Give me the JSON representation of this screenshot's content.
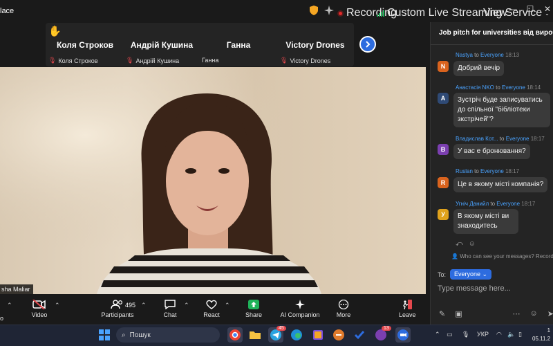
{
  "app": {
    "title": "lace"
  },
  "topbar": {
    "recording_label": "Recording",
    "live_stream_label": "Custom Live Streaming Service",
    "view_label": "View"
  },
  "participants_strip": {
    "tiles": [
      {
        "name": "Коля Строков",
        "label": "Коля Строков",
        "muted": true
      },
      {
        "name": "Андрій Кушина",
        "label": "Андрій Кушина",
        "muted": true
      },
      {
        "name": "Ганна",
        "label": "Ганна",
        "muted": false
      },
      {
        "name": "Victory Drones",
        "label": "Victory Drones",
        "muted": true
      }
    ]
  },
  "main_video": {
    "speaker_name": "sha Maliar"
  },
  "toolbar": {
    "video_label": "Video",
    "participants_label": "Participants",
    "participants_count": "495",
    "chat_label": "Chat",
    "react_label": "React",
    "share_label": "Share",
    "ai_label": "AI Companion",
    "more_label": "More",
    "leave_label": "Leave",
    "left_partial_label": "o"
  },
  "chat": {
    "title": "Job pitch for universities від вироб...",
    "messages": [
      {
        "sender": "Nastya",
        "to": "to",
        "recipient": "Everyone",
        "time": "18:13",
        "initial": "N",
        "color": "#d9631e",
        "text": "Добрий вечір"
      },
      {
        "sender": "Анастасія NKO",
        "to": "to",
        "recipient": "Everyone",
        "time": "18:14",
        "initial": "A",
        "color": "#2f4a75",
        "text": "Зустріч буде записуватись до спільної \"бібліотеки зкстрічей\"?"
      },
      {
        "sender": "Владислав Кот...",
        "to": "to",
        "recipient": "Everyone",
        "time": "18:17",
        "initial": "В",
        "color": "#7b3fb0",
        "text": "У вас е бронювання?"
      },
      {
        "sender": "Ruslan",
        "to": "to",
        "recipient": "Everyone",
        "time": "18:17",
        "initial": "R",
        "color": "#d9631e",
        "text": "Це в якому місті компанія?"
      },
      {
        "sender": "Угнiч Данийл",
        "to": "to",
        "recipient": "Everyone",
        "time": "18:17",
        "initial": "У",
        "color": "#e0a21c",
        "text": "В якому місті ви знаходитесь"
      }
    ],
    "who_can_see": "Who can see your messages? Recording",
    "to_label": "To:",
    "recipient_selected": "Everyone",
    "input_placeholder": "Type message here..."
  },
  "taskbar": {
    "search_label": "Пошук",
    "telegram_badge": "45",
    "viber_badge": "13",
    "lang": "УКР",
    "clock_time": "1",
    "clock_date": "05.11.2"
  },
  "colors": {
    "accent": "#2d6cdf",
    "share_green": "#1fb35a",
    "leave_red": "#e5484d",
    "link_blue": "#4aa3ff"
  }
}
